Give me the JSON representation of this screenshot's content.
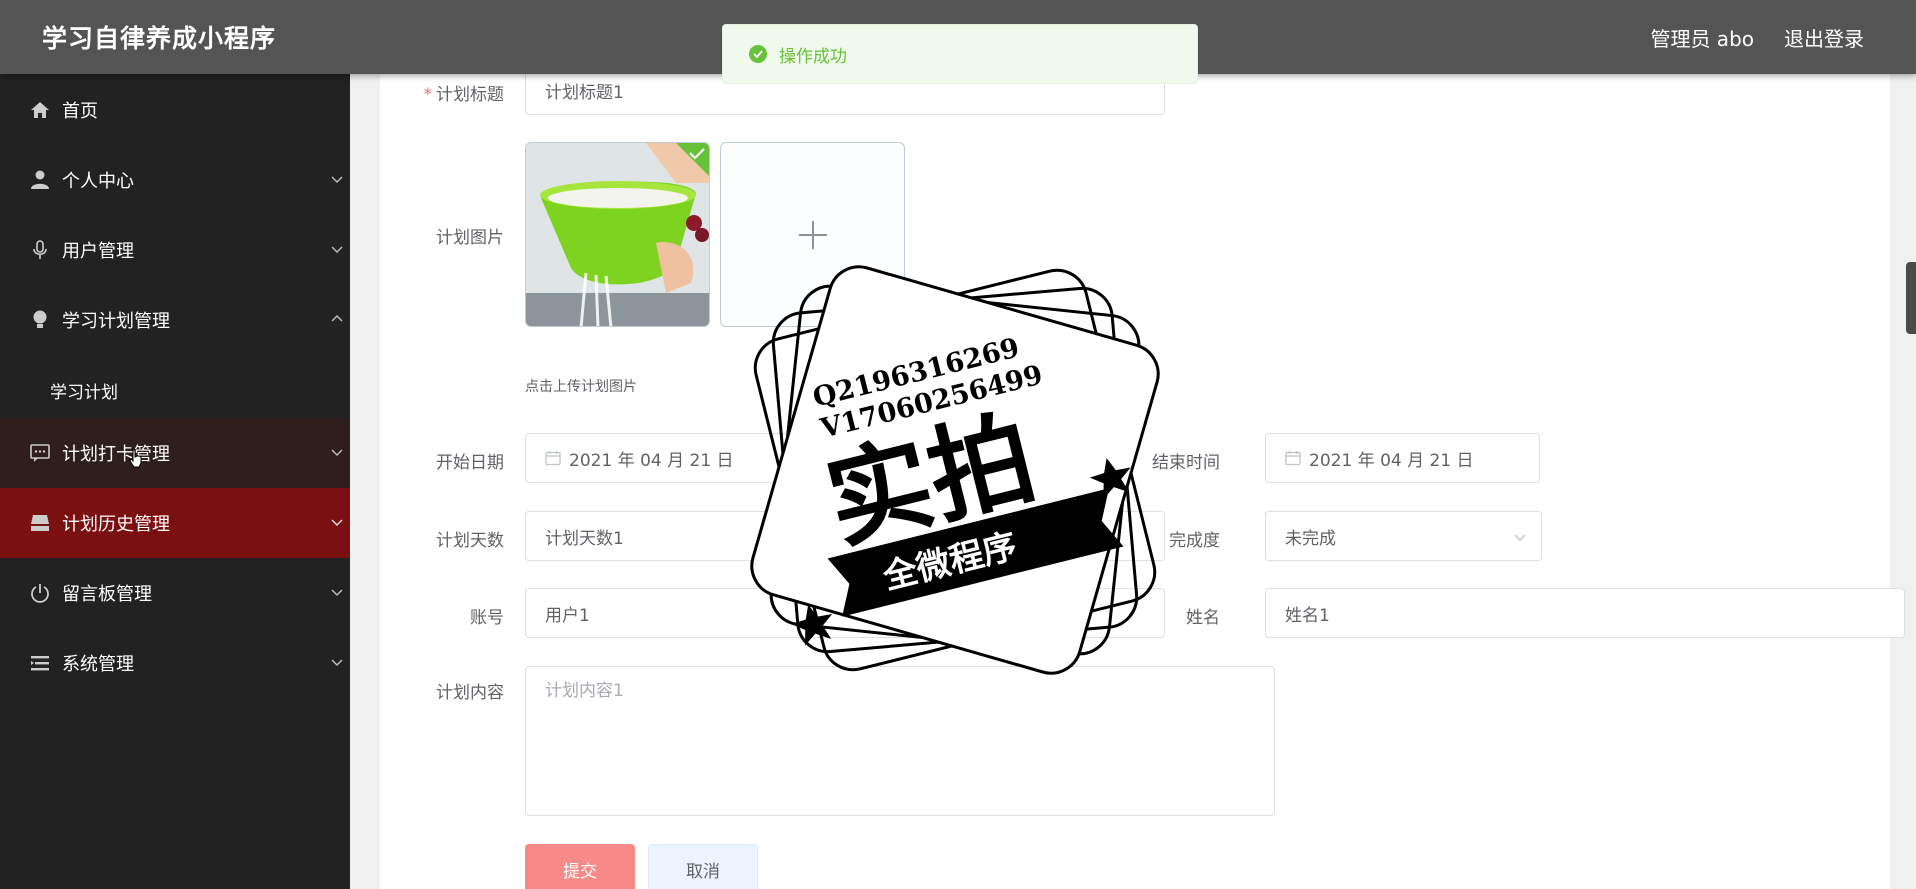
{
  "header": {
    "app_title": "学习自律养成小程序",
    "user_label": "管理员 abo",
    "logout": "退出登录"
  },
  "sidebar": {
    "items": [
      {
        "label": "首页",
        "icon": "home-icon"
      },
      {
        "label": "个人中心",
        "icon": "user-icon"
      },
      {
        "label": "用户管理",
        "icon": "microphone-icon"
      },
      {
        "label": "学习计划管理",
        "icon": "bulb-icon"
      },
      {
        "label": "学习计划",
        "icon": ""
      },
      {
        "label": "计划打卡管理",
        "icon": "chat-icon"
      },
      {
        "label": "计划历史管理",
        "icon": "inbox-icon"
      },
      {
        "label": "留言板管理",
        "icon": "power-icon"
      },
      {
        "label": "系统管理",
        "icon": "list-icon"
      }
    ]
  },
  "toast": {
    "message": "操作成功",
    "color": "#67c23a"
  },
  "form": {
    "title_label": "计划标题",
    "title_value": "计划标题1",
    "image_label": "计划图片",
    "image_hint": "点击上传计划图片",
    "start_label": "开始日期",
    "start_value": "2021 年 04 月 21 日",
    "end_label": "结束时间",
    "end_value": "2021 年 04 月 21 日",
    "days_label": "计划天数",
    "days_value": "计划天数1",
    "progress_label": "完成度",
    "progress_value": "未完成",
    "account_label": "账号",
    "account_value": "用户1",
    "name_label": "姓名",
    "name_value": "姓名1",
    "content_label": "计划内容",
    "content_placeholder": "计划内容1",
    "submit": "提交",
    "cancel": "取消"
  },
  "stamp": {
    "line1": "Q2196316269",
    "line2": "V17060256499",
    "main": "实拍",
    "banner": "全微程序"
  },
  "colors": {
    "header": "#545454",
    "sidebar": "#222222",
    "active_menu": "#7a1010",
    "submit": "#f78989"
  }
}
